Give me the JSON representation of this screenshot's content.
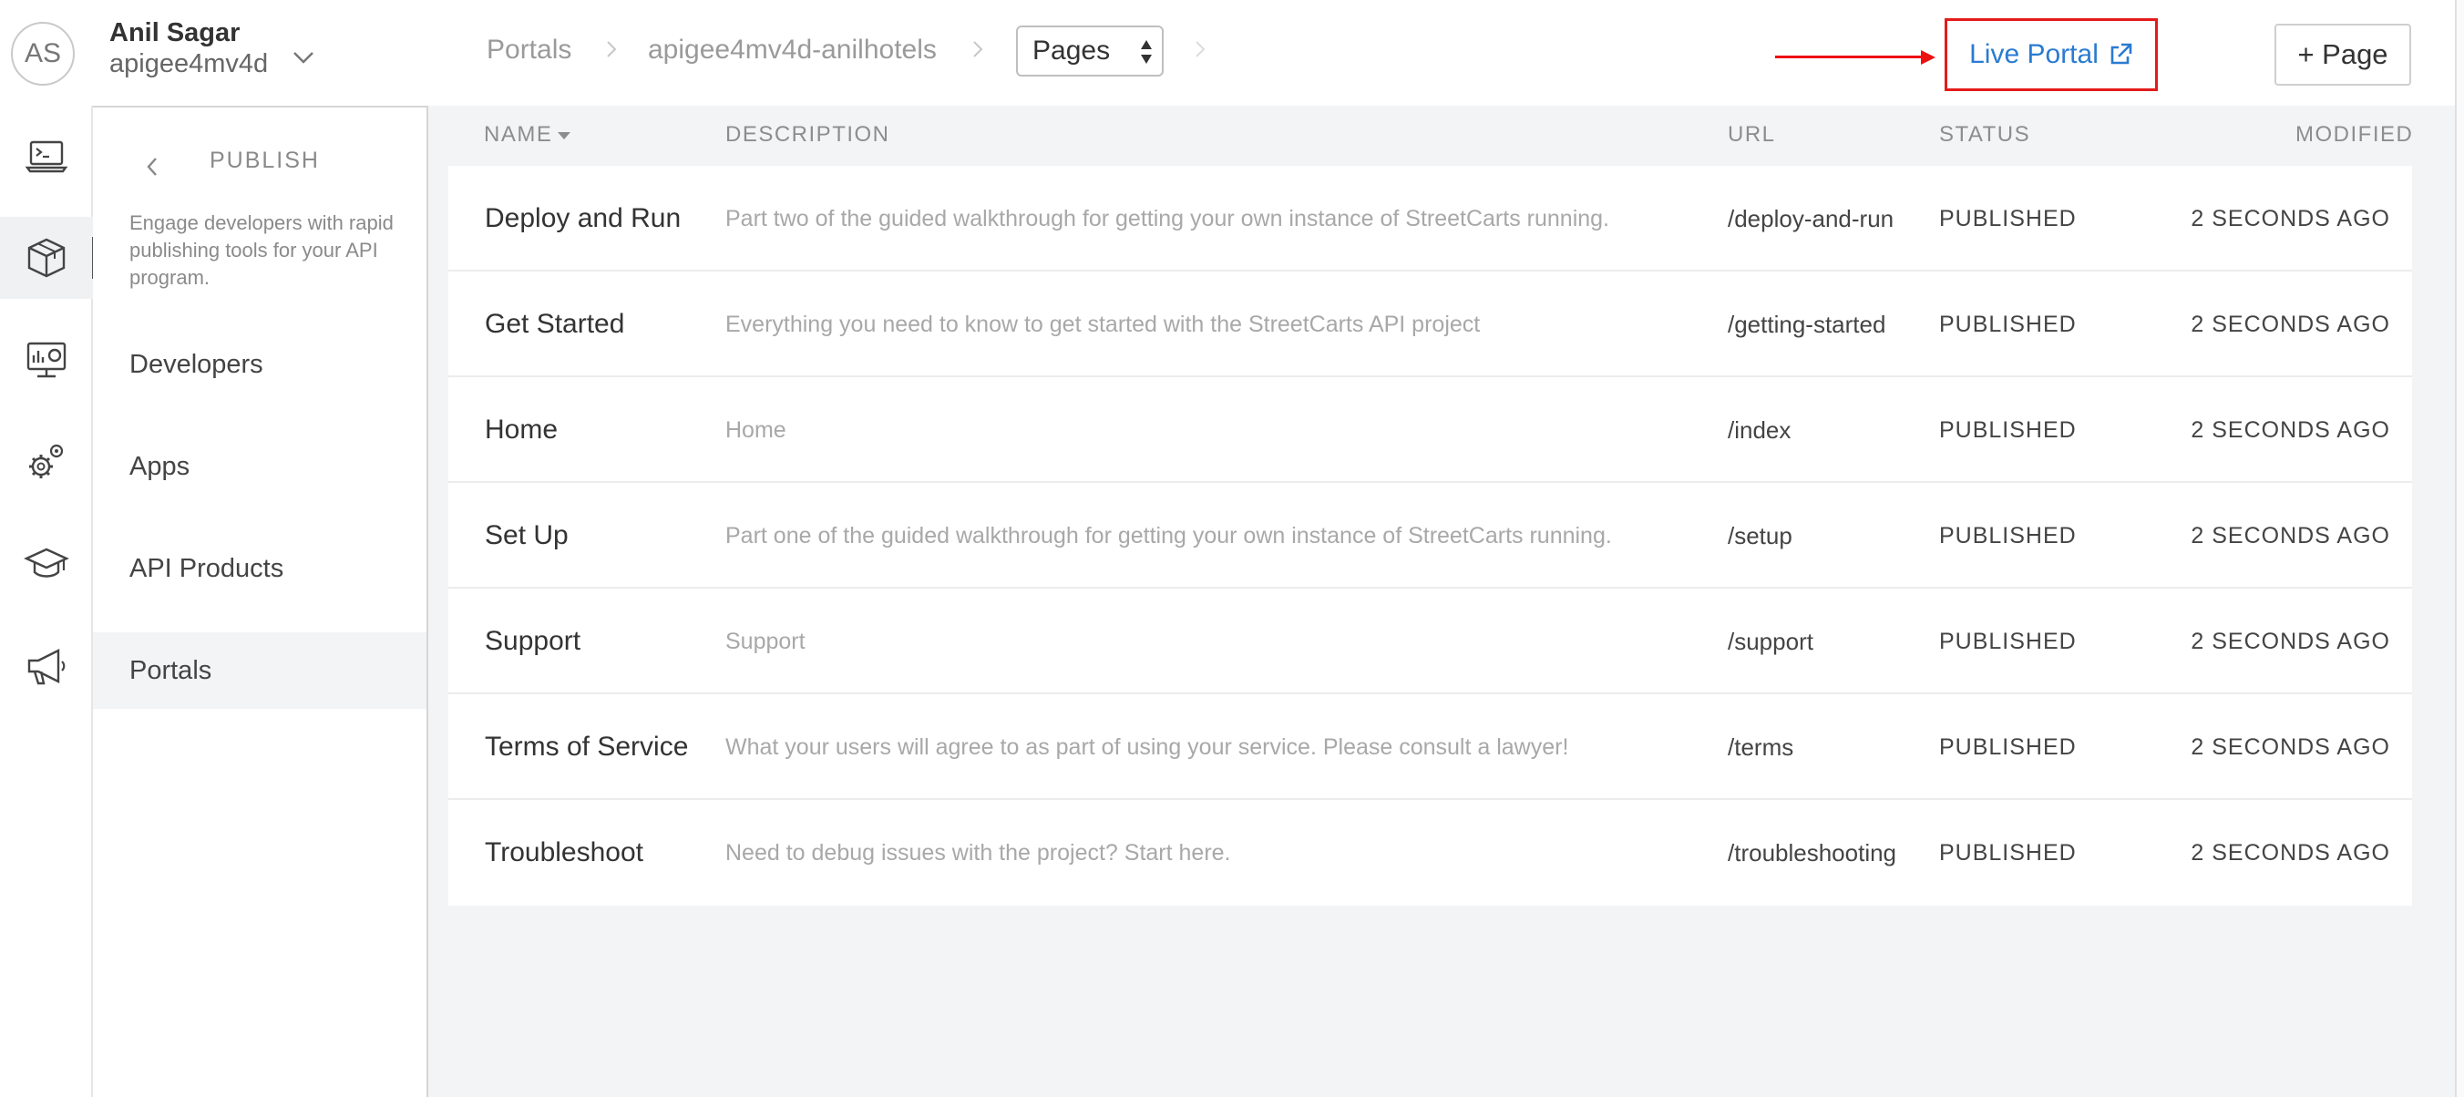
{
  "header": {
    "avatar_initials": "AS",
    "user_name": "Anil Sagar",
    "org_name": "apigee4mv4d",
    "breadcrumb": [
      "Portals",
      "apigee4mv4d-anilhotels"
    ],
    "section_select": "Pages",
    "live_portal_label": "Live Portal",
    "add_page_label": "+ Page",
    "annotation_color": "#e41b1b",
    "link_color": "#2a7bd1"
  },
  "rail": {
    "icons": [
      "terminal-icon",
      "package-icon",
      "dashboard-monitor-icon",
      "gears-icon",
      "graduation-cap-icon",
      "megaphone-icon"
    ],
    "active_index": 1
  },
  "subnav": {
    "title": "PUBLISH",
    "description": "Engage developers with rapid publishing tools for your API program.",
    "items": [
      "Developers",
      "Apps",
      "API Products",
      "Portals"
    ],
    "active_item": "Portals"
  },
  "table": {
    "columns": {
      "name": "NAME",
      "description": "DESCRIPTION",
      "url": "URL",
      "status": "STATUS",
      "modified": "MODIFIED"
    },
    "rows": [
      {
        "name": "Deploy and Run",
        "description": "Part two of the guided walkthrough for getting your own instance of StreetCarts running.",
        "url": "/deploy-and-run",
        "status": "PUBLISHED",
        "modified": "2 SECONDS AGO"
      },
      {
        "name": "Get Started",
        "description": "Everything you need to know to get started with the StreetCarts API project",
        "url": "/getting-started",
        "status": "PUBLISHED",
        "modified": "2 SECONDS AGO"
      },
      {
        "name": "Home",
        "description": "Home",
        "url": "/index",
        "status": "PUBLISHED",
        "modified": "2 SECONDS AGO"
      },
      {
        "name": "Set Up",
        "description": "Part one of the guided walkthrough for getting your own instance of StreetCarts running.",
        "url": "/setup",
        "status": "PUBLISHED",
        "modified": "2 SECONDS AGO"
      },
      {
        "name": "Support",
        "description": "Support",
        "url": "/support",
        "status": "PUBLISHED",
        "modified": "2 SECONDS AGO"
      },
      {
        "name": "Terms of Service",
        "description": "What your users will agree to as part of using your service. Please consult a lawyer!",
        "url": "/terms",
        "status": "PUBLISHED",
        "modified": "2 SECONDS AGO"
      },
      {
        "name": "Troubleshoot",
        "description": "Need to debug issues with the project? Start here.",
        "url": "/troubleshooting",
        "status": "PUBLISHED",
        "modified": "2 SECONDS AGO"
      }
    ]
  }
}
